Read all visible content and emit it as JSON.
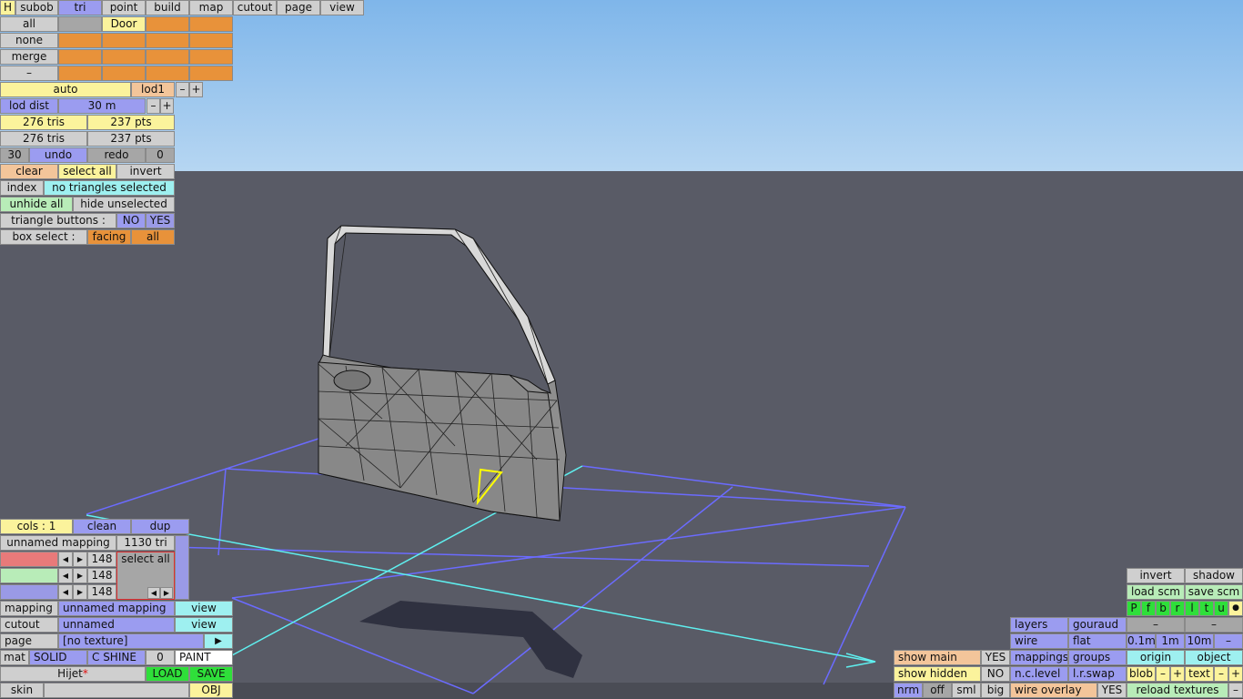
{
  "menu": [
    "H",
    "subob",
    "tri",
    "point",
    "build",
    "map",
    "cutout",
    "page",
    "view"
  ],
  "groups": {
    "items": [
      "all",
      "none",
      "merge",
      "–"
    ],
    "first_group": "Door"
  },
  "lod": {
    "auto": "auto",
    "level": "lod1",
    "minus": "–",
    "plus": "+",
    "dist_label": "lod dist",
    "dist_value": "30 m"
  },
  "counts": {
    "tris1": "276 tris",
    "pts1": "237 pts",
    "tris2": "276 tris",
    "pts2": "237 pts"
  },
  "undo": {
    "count": "30",
    "undo": "undo",
    "redo": "redo",
    "redo_count": "0"
  },
  "selection": {
    "clear": "clear",
    "select_all": "select all",
    "invert": "invert",
    "index": "index",
    "status": "no triangles selected",
    "unhide": "unhide all",
    "hide": "hide unselected"
  },
  "tri_buttons": {
    "label": "triangle buttons :",
    "no": "NO",
    "yes": "YES"
  },
  "box_select": {
    "label": "box select :",
    "facing": "facing",
    "all": "all"
  },
  "cols": {
    "label": "cols : 1",
    "clean": "clean",
    "dup": "dup",
    "mapping_name": "unnamed mapping",
    "tri_count": "1130 tri",
    "r": "148",
    "g": "148",
    "b": "148",
    "select_all": "select all"
  },
  "props": {
    "mapping": "mapping",
    "mapping_val": "unnamed mapping",
    "view": "view",
    "cutout": "cutout",
    "cutout_val": "unnamed",
    "page": "page",
    "page_val": "[no texture]",
    "arrow": "▶",
    "mat": "mat",
    "solid": "SOLID",
    "cshine": "C SHINE",
    "zero": "0",
    "paint": "PAINT",
    "name": "Hijet",
    "star": "*",
    "load": "LOAD",
    "save": "SAVE",
    "skin": "skin",
    "obj": "OBJ"
  },
  "show": {
    "main": "show main",
    "main_val": "YES",
    "hidden": "show hidden",
    "hidden_val": "NO",
    "nrm": "nrm",
    "off": "off",
    "sml": "sml",
    "big": "big"
  },
  "right": {
    "layers": "layers",
    "gouraud": "gouraud",
    "wire": "wire",
    "flat": "flat",
    "mappings": "mappings",
    "groups": "groups",
    "nclevel": "n.c.level",
    "lrswap": "l.r.swap",
    "wire_overlay": "wire overlay",
    "wire_overlay_val": "YES"
  },
  "far": {
    "invert": "invert",
    "shadow": "shadow",
    "load_scm": "load scm",
    "save_scm": "save scm",
    "views": [
      "P",
      "f",
      "b",
      "r",
      "l",
      "t",
      "u",
      "●"
    ],
    "dash": "–",
    "d01": "0.1m",
    "d1": "1m",
    "d10": "10m",
    "origin": "origin",
    "object": "object",
    "blob": "blob",
    "minus": "–",
    "plus": "+",
    "text": "text",
    "reload": "reload textures"
  },
  "colors": {
    "sky": "#9cc6ef",
    "ground": "#595b66",
    "grid_blue": "#6b6bff",
    "grid_cyan": "#5ff0f0",
    "selected_tri": "#ffff00"
  }
}
